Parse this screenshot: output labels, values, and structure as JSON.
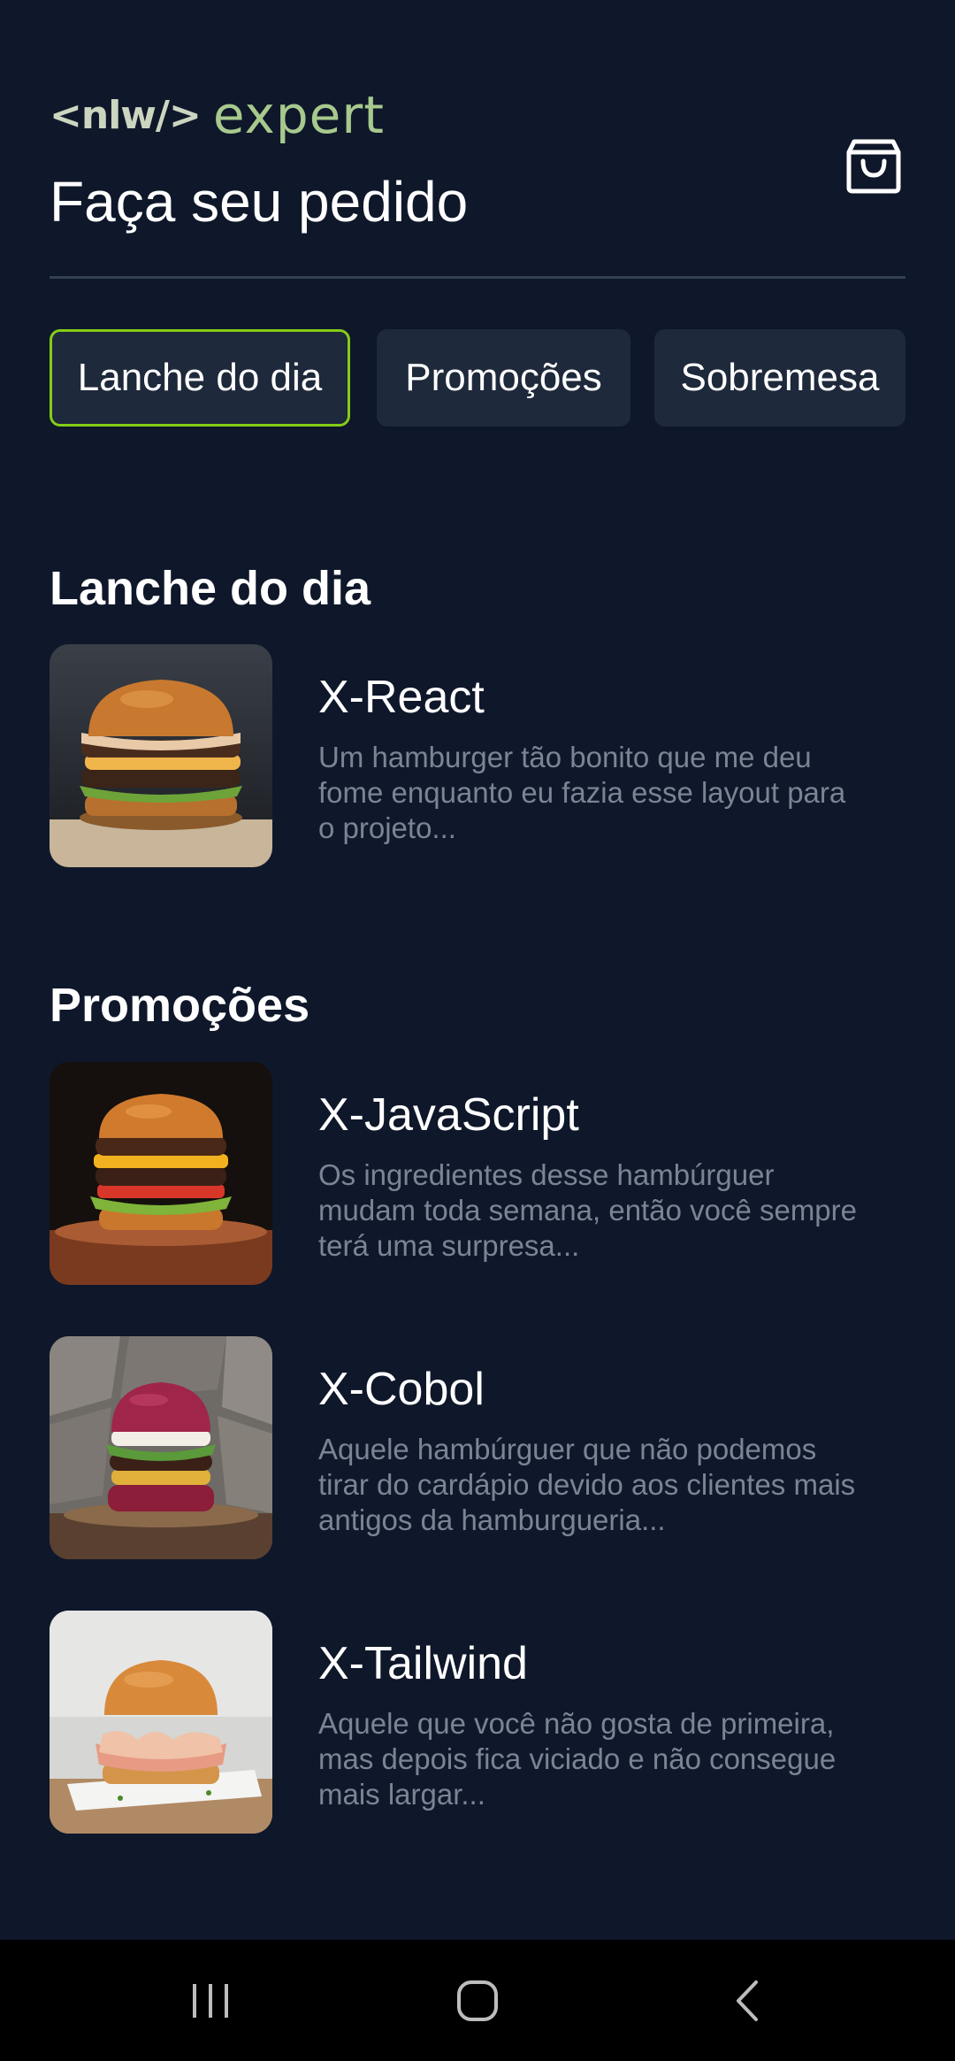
{
  "app": {
    "logo_prefix": "<nlw/>",
    "logo_text": "expert"
  },
  "header": {
    "title": "Faça seu pedido",
    "cart_icon": "shopping-bag-icon"
  },
  "tabs": [
    {
      "label": "Lanche do dia",
      "active": true
    },
    {
      "label": "Promoções",
      "active": false
    },
    {
      "label": "Sobremesa",
      "active": false
    }
  ],
  "sections": [
    {
      "title": "Lanche do dia",
      "items": [
        {
          "name": "X-React",
          "description": "Um hamburger tão bonito que me deu fome enquanto eu fazia esse layout para o projeto..."
        }
      ]
    },
    {
      "title": "Promoções",
      "items": [
        {
          "name": "X-JavaScript",
          "description": "Os ingredientes desse hambúrguer mudam toda semana, então você sempre terá uma surpresa..."
        },
        {
          "name": "X-Cobol",
          "description": "Aquele hambúrguer que não podemos tirar do cardápio devido aos clientes mais antigos da hamburgueria..."
        },
        {
          "name": "X-Tailwind",
          "description": "Aquele que você não gosta de primeira, mas depois fica viciado e não consegue mais largar..."
        }
      ]
    }
  ],
  "navbar": {
    "recent_icon": "recent-apps-icon",
    "home_icon": "home-icon",
    "back_icon": "back-icon"
  },
  "colors": {
    "background": "#0f172a",
    "surface": "#1e293b",
    "accent": "#84cc16",
    "muted_text": "#7b8494"
  }
}
